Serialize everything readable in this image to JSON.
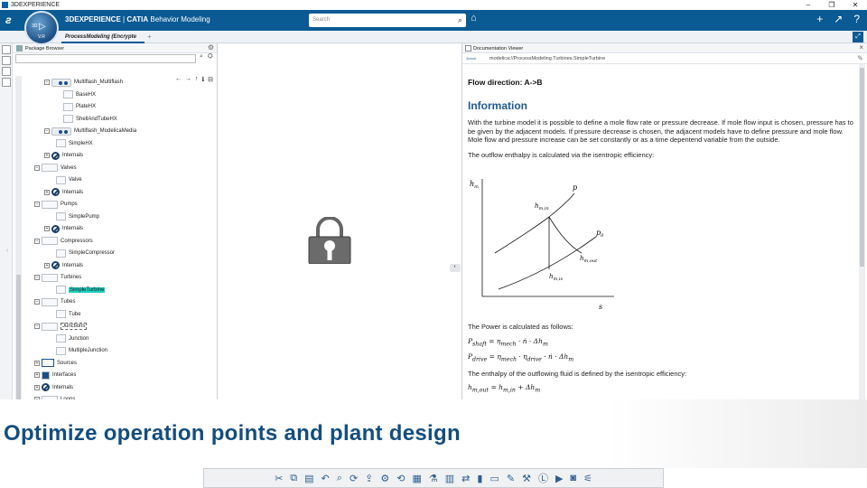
{
  "os": {
    "title": "3DEXPERIENCE"
  },
  "app": {
    "brand_bold": "3DEXPERIENCE",
    "brand_sep": " | ",
    "brand_app": "CATIA",
    "brand_module": " Behavior Modeling",
    "compass_version": "V.R",
    "compass_3d": "3D"
  },
  "search": {
    "placeholder": "Search"
  },
  "tab": {
    "label": "ProcessModeling (Encrypte",
    "add": "+"
  },
  "package_browser": {
    "title": "Package Browser",
    "tree": [
      {
        "label": "Multiflash_Multiflash",
        "kind": "pkg",
        "x": 35
      },
      {
        "label": "BaseHX",
        "kind": "model",
        "x": 56
      },
      {
        "label": "PlateHX",
        "kind": "model",
        "x": 56
      },
      {
        "label": "ShellAndTubeHX",
        "kind": "model",
        "x": 56
      },
      {
        "label": "Multiflash_ModelicaMedia",
        "kind": "pkg",
        "x": 35
      },
      {
        "label": "SimpleHX",
        "kind": "model",
        "x": 48
      },
      {
        "label": "Internals",
        "kind": "none",
        "x": 35
      },
      {
        "label": "Valves",
        "kind": "folder",
        "x": 24
      },
      {
        "label": "Valve",
        "kind": "model",
        "x": 48
      },
      {
        "label": "Internals",
        "kind": "none",
        "x": 35
      },
      {
        "label": "Pumps",
        "kind": "folder",
        "x": 24
      },
      {
        "label": "SimplePump",
        "kind": "model",
        "x": 48
      },
      {
        "label": "Internals",
        "kind": "none",
        "x": 35
      },
      {
        "label": "Compressors",
        "kind": "folder",
        "x": 24
      },
      {
        "label": "SimpleCompressor",
        "kind": "model",
        "x": 48
      },
      {
        "label": "Internals",
        "kind": "none",
        "x": 35
      },
      {
        "label": "Turbines",
        "kind": "folder",
        "x": 24
      },
      {
        "label": "SimpleTurbine",
        "kind": "model-sel",
        "x": 48
      },
      {
        "label": "Tubes",
        "kind": "folder",
        "x": 24
      },
      {
        "label": "Tube",
        "kind": "model",
        "x": 48
      },
      {
        "label": "Junctions",
        "kind": "folder-box",
        "x": 24
      },
      {
        "label": "Junction",
        "kind": "model",
        "x": 48
      },
      {
        "label": "MultipleJunction",
        "kind": "model",
        "x": 48
      },
      {
        "label": "Sources",
        "kind": "src",
        "x": 24
      },
      {
        "label": "Interfaces",
        "kind": "intf",
        "x": 24
      },
      {
        "label": "Internals",
        "kind": "none",
        "x": 24
      },
      {
        "label": "Loops",
        "kind": "folder",
        "x": 24
      }
    ]
  },
  "doc_viewer": {
    "title": "Documentation Viewer",
    "url": "modelica://ProcessModeling.Turbines.SimpleTurbine",
    "flow_direction": "Flow direction: A->B",
    "heading": "Information",
    "para1": "With the turbine model it is possible to define a mole flow rate or pressure decrease. If mole flow input is chosen, pressure has to be given by the adjacent models. If pressure decrease is chosen, the adjacent models have to define pressure and mole flow. Mole flow and pressure increase can be set constantly or as a time depentend variable from the outside.",
    "para2": "The outflow enthalpy is calculated via the isentropic efficiency:",
    "diagram": {
      "y_axis": "h",
      "y_axis_sub": "m",
      "x_axis": "s",
      "curve_p": "p",
      "curve_p0": "p",
      "curve_p0_sub": "0",
      "h_in": "h",
      "h_in_sub": "m,in",
      "h_out": "h",
      "h_out_sub": "m,out",
      "h_is": "h",
      "h_is_sub": "m,is"
    },
    "para3": "The Power is calculated as follows:",
    "eq1": "P",
    "eq1_sub": "shaft",
    "eq1_rhs": " = η",
    "eq1_rhs_sub": "mech",
    "eq1_tail": " · ṅ · Δh",
    "eq1_tail_sub": "m",
    "eq2": "P",
    "eq2_sub": "drive",
    "eq2_rhs": " = η",
    "eq2_rhs_sub": "mech",
    "eq2_mid": " · η",
    "eq2_mid_sub": "drive",
    "eq2_tail": " · ṅ · Δh",
    "eq2_tail_sub": "m",
    "para4": "The enthalpy of the outflowing fluid is defined by the isentropic efficiency:",
    "eq3": "h",
    "eq3_sub": "m,out",
    "eq3_rhs": " = h",
    "eq3_rhs_sub": "m,in",
    "eq3_tail": " + Δh",
    "eq3_tail_sub": "m"
  },
  "banner": {
    "text": "Optimize operation points and plant design"
  },
  "colors": {
    "topbar": "#0a5a93",
    "selection": "#1fd1c2",
    "heading": "#1f5a8e",
    "banner_text": "#134d7e"
  }
}
